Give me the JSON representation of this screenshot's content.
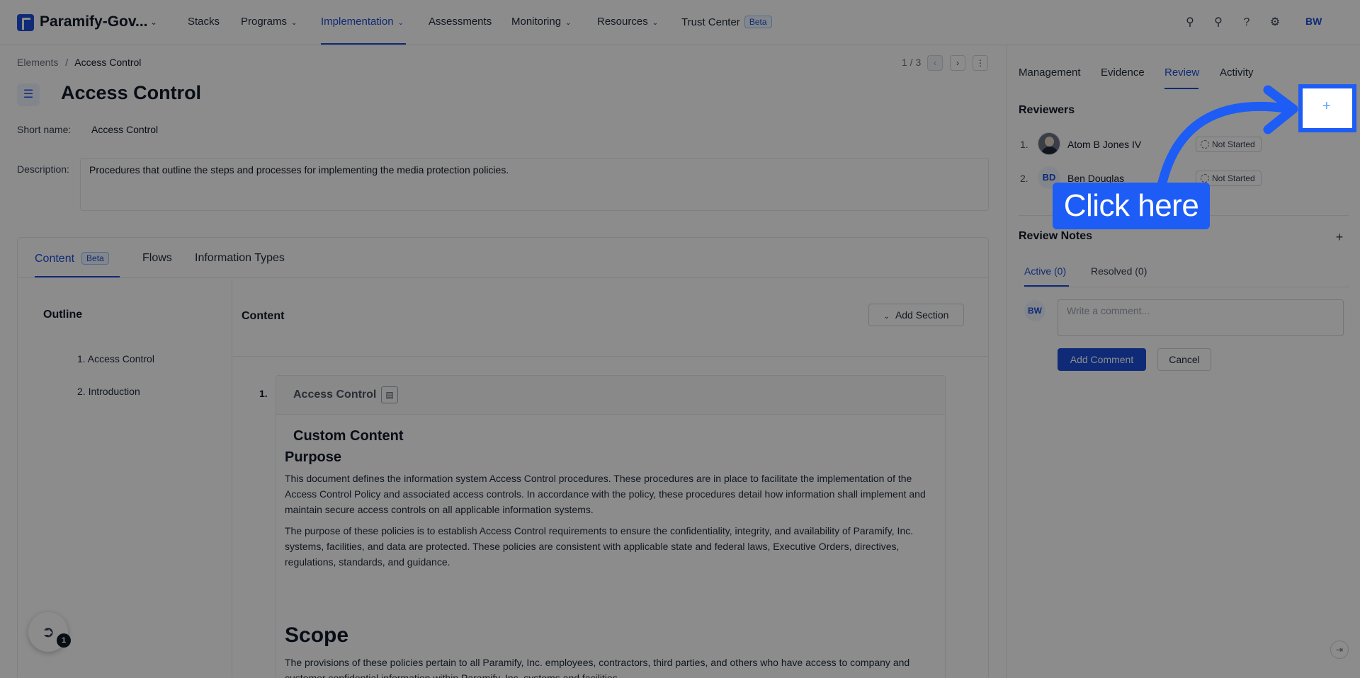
{
  "topnav": {
    "brand": "Paramify-Gov...",
    "items": [
      {
        "label": "Stacks",
        "dropdown": false
      },
      {
        "label": "Programs",
        "dropdown": true
      },
      {
        "label": "Implementation",
        "dropdown": true,
        "active": true
      },
      {
        "label": "Assessments",
        "dropdown": false
      },
      {
        "label": "Monitoring",
        "dropdown": true
      },
      {
        "label": "Resources",
        "dropdown": true
      },
      {
        "label": "Trust Center",
        "badge": "Beta"
      }
    ],
    "user_initials": "BW",
    "icons": [
      "search-icon",
      "bell-icon",
      "help-icon",
      "gear-icon"
    ]
  },
  "breadcrumb": {
    "root": "Elements",
    "separator": "/",
    "current": "Access Control"
  },
  "pager": {
    "text": "1 / 3"
  },
  "element": {
    "title": "Access Control",
    "short_name_label": "Short name",
    "short_name": "Access Control",
    "description_label": "Description",
    "description": "Procedures that outline the steps and processes for implementing the media protection policies."
  },
  "content_tabs": {
    "content": "Content",
    "content_badge": "Beta",
    "flows": "Flows",
    "information_types": "Information Types"
  },
  "outline": {
    "title": "Outline",
    "items": [
      "1. Access Control",
      "2. Introduction"
    ]
  },
  "content_panel": {
    "title": "Content",
    "add_section": "Add Section",
    "section_number": "1.",
    "section_title": "Access Control",
    "custom_title": "Custom Content",
    "purpose_heading": "Purpose",
    "paragraph_1": "This document defines the information system Access Control procedures. These procedures are in place to facilitate the implementation of the Access Control Policy and associated access controls. In accordance with the policy, these procedures detail how information shall implement and maintain secure access controls on all applicable information systems.",
    "paragraph_2": "The purpose of these policies is to establish Access Control requirements to ensure the confidentiality, integrity, and availability of Paramify, Inc. systems, facilities, and data are protected. These policies are consistent with applicable state and federal laws, Executive Orders, directives, regulations, standards, and guidance.",
    "scope_heading": "Scope",
    "paragraph_3": "The provisions of these policies pertain to all Paramify, Inc. employees, contractors, third parties, and others who have access to company and customer confidential information within Paramify, Inc. systems and facilities."
  },
  "helper": {
    "badge": "1"
  },
  "right_panel": {
    "tabs": [
      "Management",
      "Evidence",
      "Review",
      "Activity"
    ],
    "active_tab": "Review",
    "reviewers_title": "Reviewers",
    "reviewers": [
      {
        "number": "1.",
        "name": "Atom B Jones IV",
        "status": "Not Started"
      },
      {
        "number": "2.",
        "name": "Ben Douglas",
        "initials": "BD",
        "status": "Not Started"
      }
    ],
    "notes_title": "Review Notes",
    "note_tabs": {
      "active": "Active (0)",
      "resolved": "Resolved (0)"
    },
    "comment_avatar": "BW",
    "comment_placeholder": "Write a comment...",
    "add_comment": "Add Comment",
    "cancel": "Cancel"
  },
  "callout": {
    "text": "Click here",
    "color": "#1d5cf5"
  },
  "colors": {
    "accent": "#1d4ed8",
    "callout": "#1d5cf5"
  }
}
